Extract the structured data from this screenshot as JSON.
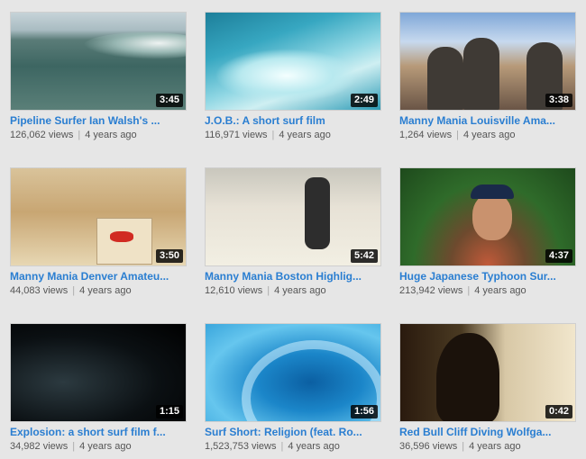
{
  "videos": [
    {
      "title": "Pipeline Surfer Ian Walsh's ...",
      "duration": "3:45",
      "views": "126,062 views",
      "age": "4 years ago"
    },
    {
      "title": "J.O.B.: A short surf film",
      "duration": "2:49",
      "views": "116,971 views",
      "age": "4 years ago"
    },
    {
      "title": "Manny Mania Louisville Ama...",
      "duration": "3:38",
      "views": "1,264 views",
      "age": "4 years ago"
    },
    {
      "title": "Manny Mania Denver Amateu...",
      "duration": "3:50",
      "views": "44,083 views",
      "age": "4 years ago"
    },
    {
      "title": "Manny Mania Boston Highlig...",
      "duration": "5:42",
      "views": "12,610 views",
      "age": "4 years ago"
    },
    {
      "title": "Huge Japanese Typhoon Sur...",
      "duration": "4:37",
      "views": "213,942 views",
      "age": "4 years ago"
    },
    {
      "title": "Explosion: a short surf film f...",
      "duration": "1:15",
      "views": "34,982 views",
      "age": "4 years ago"
    },
    {
      "title": "Surf Short: Religion (feat. Ro...",
      "duration": "1:56",
      "views": "1,523,753 views",
      "age": "4 years ago"
    },
    {
      "title": "Red Bull Cliff Diving Wolfga...",
      "duration": "0:42",
      "views": "36,596 views",
      "age": "4 years ago"
    }
  ],
  "separator": "|",
  "colors": {
    "title_link": "#2a7ed1",
    "meta_text": "#555555",
    "background": "#e6e6e6",
    "duration_badge": "#000000"
  }
}
